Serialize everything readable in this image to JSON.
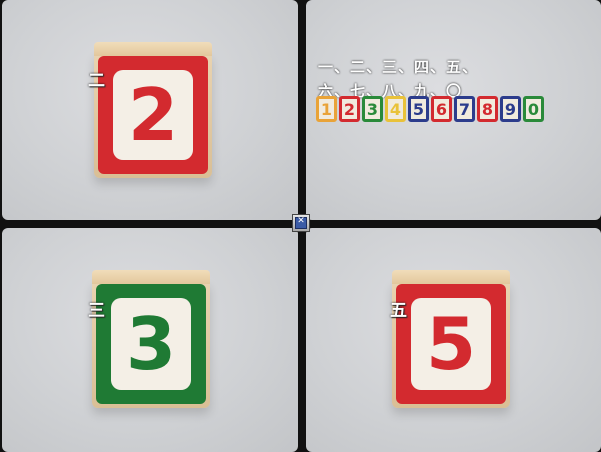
{
  "panels": {
    "top_left": {
      "label": "二",
      "digit": "2",
      "frame_color": "#d32a2f",
      "digit_color": "#d32a2f"
    },
    "top_right": {
      "line1": "一、二、三、四、五、",
      "line2": "六、七、八、九、〇",
      "blocks": [
        {
          "digit": "1",
          "color": "#e9a338"
        },
        {
          "digit": "2",
          "color": "#d32a2f"
        },
        {
          "digit": "3",
          "color": "#2a8a3a"
        },
        {
          "digit": "4",
          "color": "#e9c23a"
        },
        {
          "digit": "5",
          "color": "#2c3c8c"
        },
        {
          "digit": "6",
          "color": "#d32a2f"
        },
        {
          "digit": "7",
          "color": "#2c3c8c"
        },
        {
          "digit": "8",
          "color": "#d32a2f"
        },
        {
          "digit": "9",
          "color": "#2c3c8c"
        },
        {
          "digit": "0",
          "color": "#2a8a3a"
        }
      ]
    },
    "bottom_left": {
      "label": "三",
      "digit": "3",
      "frame_color": "#1f7a34",
      "digit_color": "#1f7a34"
    },
    "bottom_right": {
      "label": "五",
      "digit": "5",
      "frame_color": "#d32a2f",
      "digit_color": "#d32a2f"
    }
  },
  "center_control": {
    "icon": "expand-icon"
  }
}
